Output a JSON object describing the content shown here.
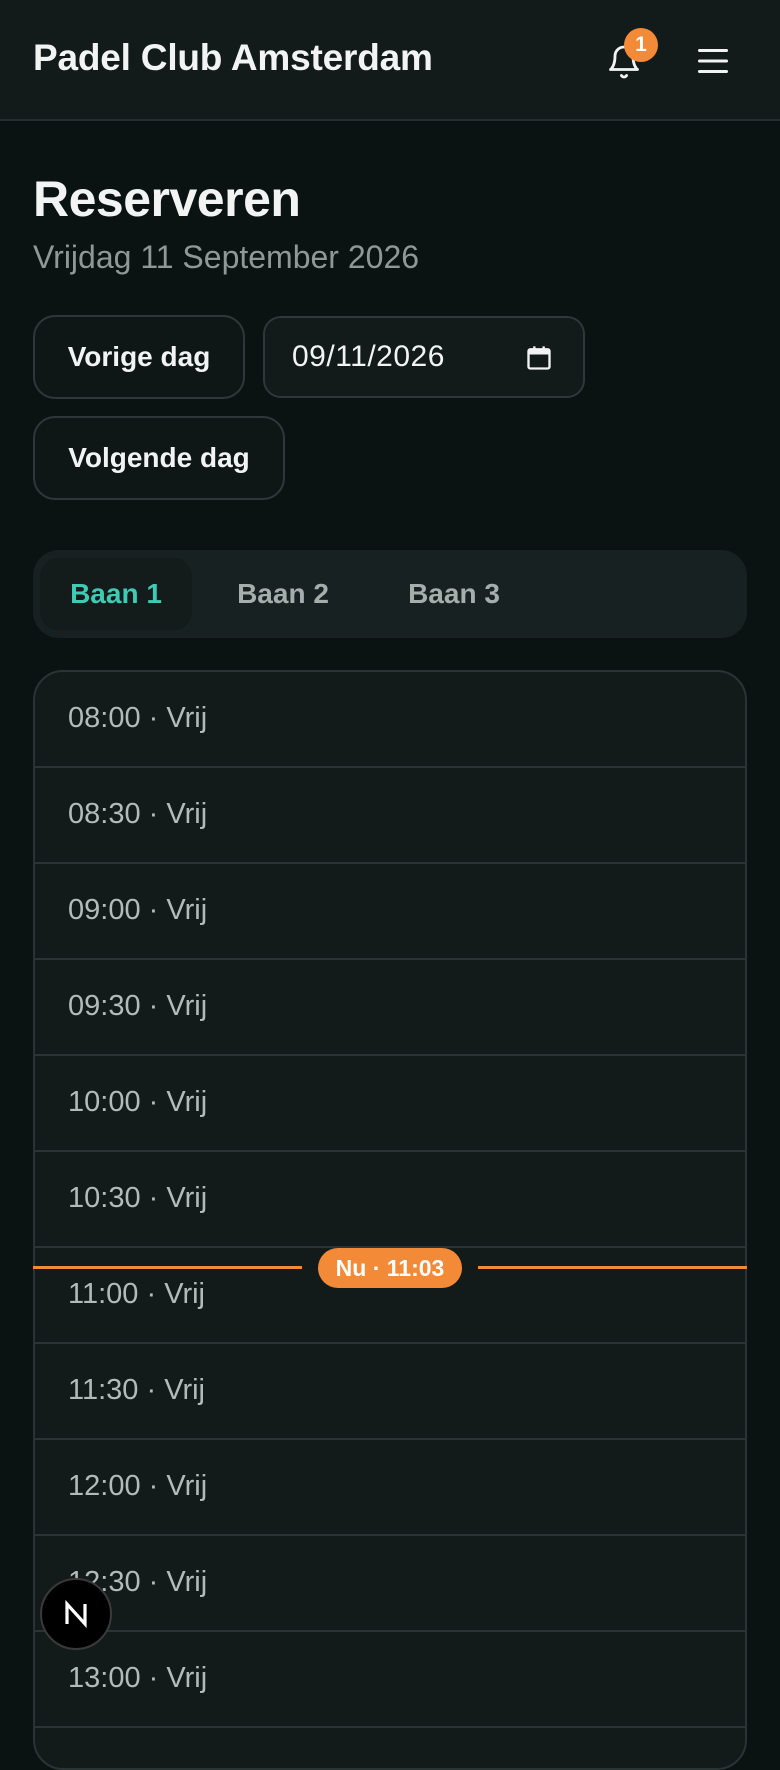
{
  "header": {
    "app_title": "Padel Club Amsterdam",
    "notification_count": "1",
    "bell_icon": "bell-icon",
    "menu_icon": "hamburger-menu-icon"
  },
  "page": {
    "title": "Reserveren",
    "date_label": "Vrijdag 11 September 2026"
  },
  "controls": {
    "prev_day_label": "Vorige dag",
    "next_day_label": "Volgende dag",
    "date_value": "09/11/2026",
    "calendar_icon": "calendar-icon"
  },
  "tabs": [
    {
      "label": "Baan 1",
      "active": true
    },
    {
      "label": "Baan 2",
      "active": false
    },
    {
      "label": "Baan 3",
      "active": false
    }
  ],
  "slots": [
    {
      "label": "08:00 · Vrij"
    },
    {
      "label": "08:30 · Vrij"
    },
    {
      "label": "09:00 · Vrij"
    },
    {
      "label": "09:30 · Vrij"
    },
    {
      "label": "10:00 · Vrij"
    },
    {
      "label": "10:30 · Vrij"
    },
    {
      "label": "11:00 · Vrij"
    },
    {
      "label": "11:30 · Vrij"
    },
    {
      "label": "12:00 · Vrij"
    },
    {
      "label": "12:30 · Vrij"
    },
    {
      "label": "13:00 · Vrij"
    }
  ],
  "now_indicator": {
    "label": "Nu · 11:03"
  },
  "colors": {
    "accent": "#3fcab3",
    "now": "#f28a38",
    "background": "#0b1212"
  },
  "floating_button": {
    "icon": "nextjs-logo-icon",
    "letter": "N"
  }
}
